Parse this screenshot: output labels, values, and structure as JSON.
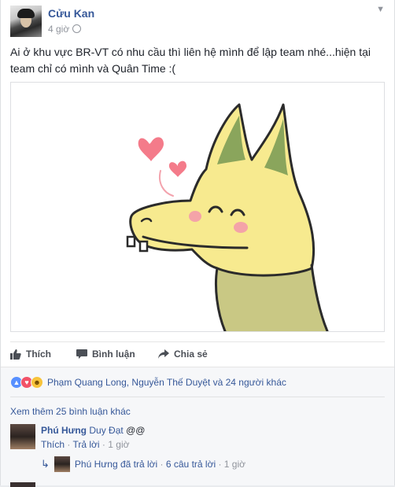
{
  "post": {
    "author": "Cửu Kan",
    "time": "4 giờ",
    "text": "Ai ở khu vực BR-VT có nhu cầu thì liên hệ mình để lập team nhé...hiện tại team chỉ có mình và Quân Time :("
  },
  "actions": {
    "like": "Thích",
    "comment": "Bình luận",
    "share": "Chia sẻ"
  },
  "reactions": {
    "summary": "Phạm Quang Long, Nguyễn Thế Duyệt và 24 người khác",
    "types": [
      "like",
      "love",
      "haha"
    ]
  },
  "comments": {
    "view_more": "Xem thêm 25 bình luận khác",
    "items": [
      {
        "author": "Phú Hưng",
        "tag": "Duy Đạt",
        "text": "@@",
        "like_label": "Thích",
        "reply_label": "Trả lời",
        "time": "1 giờ",
        "reply_summary": {
          "text": "Phú Hưng đã trả lời",
          "count": "6 câu trả lời",
          "time": "1 giờ"
        }
      }
    ]
  },
  "colors": {
    "link": "#365899",
    "muted": "#90949c",
    "text": "#1d2129",
    "dragon_body": "#f7ea8f",
    "dragon_ear_inner": "#8aa55c",
    "heart": "#f47b8a"
  },
  "icons": {
    "like": "thumbs-up-icon",
    "comment": "speech-bubble-icon",
    "share": "share-arrow-icon",
    "menu": "chevron-down-icon"
  }
}
